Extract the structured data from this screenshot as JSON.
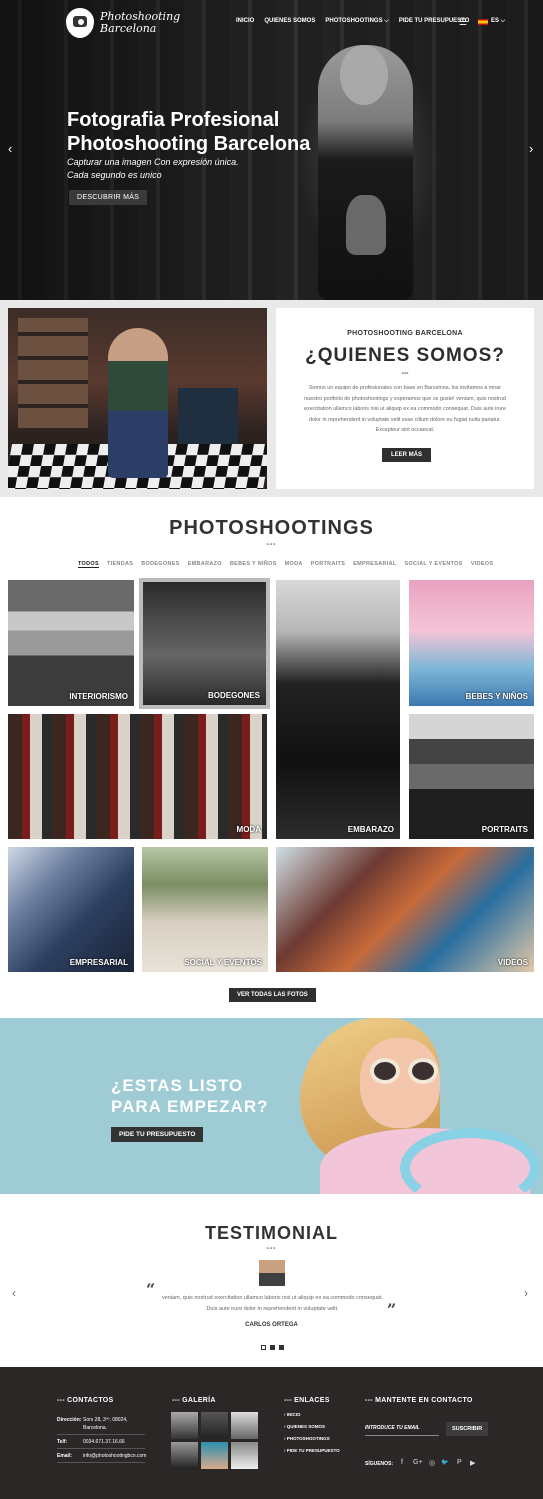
{
  "brand": {
    "name_line1": "Photoshooting",
    "name_line2": "Barcelona"
  },
  "nav": {
    "items": [
      "INICIO",
      "QUIENES SOMOS",
      "PHOTOSHOOTINGS ⌵",
      "PIDE TU PRESUPUESTO"
    ],
    "menu_icon": "hamburger-icon",
    "lang": "ES ⌵"
  },
  "hero": {
    "title_line1": "Fotografia Profesional",
    "title_line2": "Photoshooting Barcelona",
    "sub_line1": "Capturar una imagen Con expresión única.",
    "sub_line2": "Cada segundo es unico",
    "button": "DESCUBRIR MÁS",
    "prev": "‹",
    "next": "›"
  },
  "about": {
    "kicker": "PHOTOSHOOTING BARCELONA",
    "title": "¿QUIENES SOMOS?",
    "dash": "---",
    "body": "Somos un equipo de profesionales con base en Barcelona, los invitamos a mirar nuestro portfolio de photoshootings y esperamos que os guste! veniam, quis nostrud exercitation ullamco laboris nisi ut aliquip ex ea commodo consequat. Duis aute irure dolor in reprehenderit in voluptate velit esse cillum dolore eu fugiat nulla pariatur. Excepteur sint occaecat.",
    "button": "LEER MÁS"
  },
  "portfolio": {
    "title": "PHOTOSHOOTINGS",
    "dash": "---",
    "filters": [
      "TODOS",
      "TIENDAS",
      "BODEGONES",
      "EMBARAZO",
      "BEBES Y NIÑOS",
      "MODA",
      "PORTRAITS",
      "EMPRESARIAL",
      "SOCIAL Y EVENTOS",
      "VIDEOS"
    ],
    "tiles": {
      "interiorismo": "INTERIORISMO",
      "bodegones": "BODEGONES",
      "embarazo": "EMBARAZO",
      "bebes": "BEBES Y NIÑOS",
      "moda": "MODA",
      "portraits": "PORTRAITS",
      "empresarial": "EMPRESARIAL",
      "social": "SOCIAL Y EVENTOS",
      "videos": "VIDEOS"
    },
    "button": "VER TODAS LAS FOTOS"
  },
  "cta": {
    "title_line1": "¿ESTAS LISTO",
    "title_line2": "PARA EMPEZAR?",
    "button": "PIDE TU PRESUPUESTO"
  },
  "testimonial": {
    "title": "TESTIMONIAL",
    "dash": "---",
    "open_quote": "“",
    "close_quote": "”",
    "body": "veniam, quis nostrud exercitation ullamco laboris nisi ut aliquip ex ea commodo consequat. Duis aute irure dolor in reprehenderit in voluptate velit.",
    "name": "CARLOS ORTEGA",
    "prev": "‹",
    "next": "›"
  },
  "footer": {
    "contact_title": "--- CONTACTOS",
    "address_label": "Dirección:",
    "address_line1": "Sors 28, 3ºº, 08024,",
    "address_line2": "Barcelona.",
    "phone_label": "Telf:",
    "phone": "0034.671.37.16.66",
    "email_label": "Email:",
    "email": "info@photoshootingbcn.com",
    "gallery_title": "--- GALERÍA",
    "links_title": "--- ENLACES",
    "links": [
      "INICIO",
      "QUIENES SOMOS",
      "PHOTOSHOOTINGS",
      "PIDE TU PRESUPUESTO"
    ],
    "newsletter_title": "--- MANTENTE EN CONTACTO",
    "email_placeholder": "INTRODUCE TU EMAIL",
    "subscribe": "SUSCRIBIR",
    "follow": "SÍGUENOS:",
    "social": [
      "f",
      "G+",
      "◎",
      "🐦",
      "P",
      "▶"
    ]
  }
}
